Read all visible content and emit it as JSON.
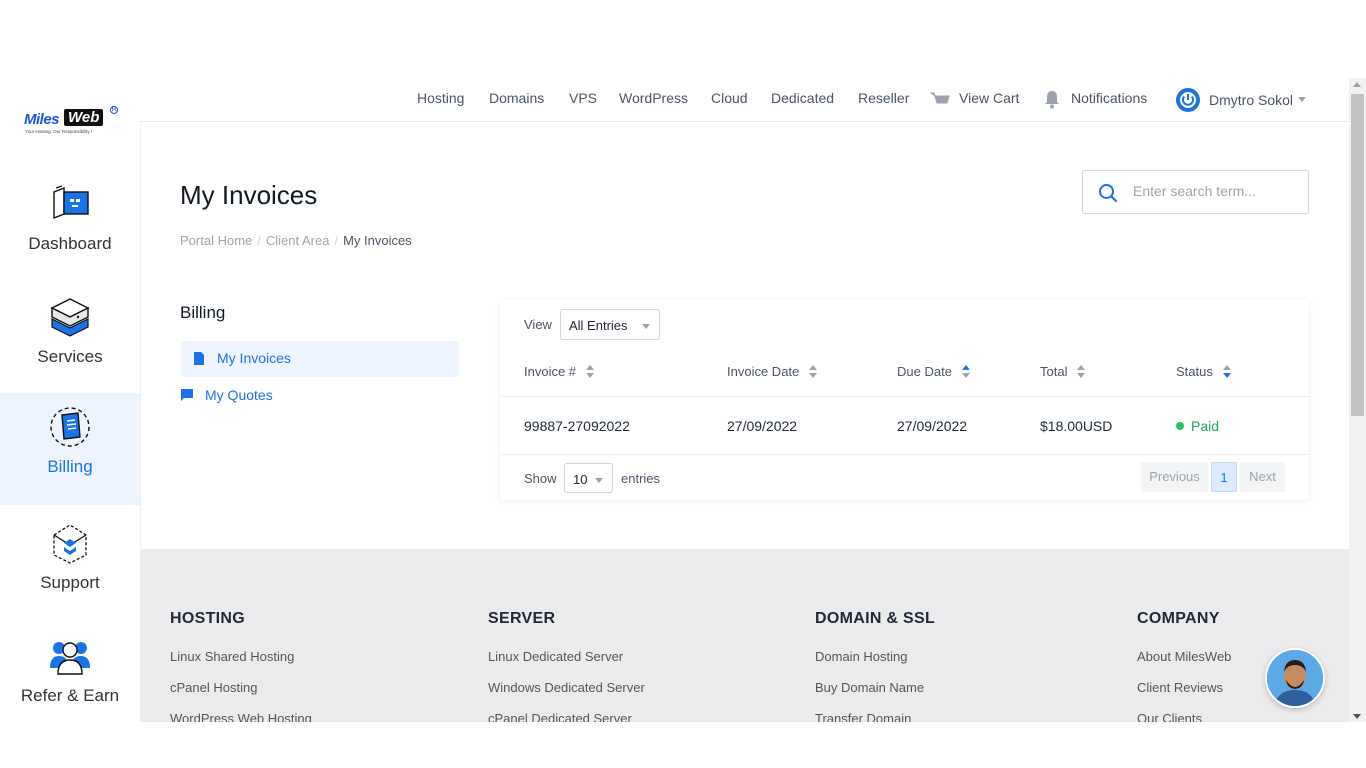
{
  "brand": {
    "name_part1": "Miles",
    "name_part2": "Web",
    "tagline": "Your Hosting, Our Responsibility !",
    "accent_color": "#1a73e8"
  },
  "sidebar": {
    "items": [
      {
        "label": "Dashboard",
        "icon": "dashboard-icon",
        "active": false
      },
      {
        "label": "Services",
        "icon": "services-icon",
        "active": false
      },
      {
        "label": "Billing",
        "icon": "billing-icon",
        "active": true
      },
      {
        "label": "Support",
        "icon": "support-icon",
        "active": false
      },
      {
        "label": "Refer & Earn",
        "icon": "refer-earn-icon",
        "active": false
      }
    ]
  },
  "topnav": {
    "links": [
      "Hosting",
      "Domains",
      "VPS",
      "WordPress",
      "Cloud",
      "Dedicated",
      "Reseller"
    ],
    "cart_label": "View Cart",
    "notifications_label": "Notifications",
    "user_name": "Dmytro Sokol"
  },
  "page": {
    "title": "My Invoices",
    "breadcrumb": [
      "Portal Home",
      "Client Area",
      "My Invoices"
    ],
    "search_placeholder": "Enter search term..."
  },
  "billing_menu": {
    "heading": "Billing",
    "items": [
      {
        "label": "My Invoices",
        "active": true
      },
      {
        "label": "My Quotes",
        "active": false
      }
    ]
  },
  "table": {
    "view_label": "View",
    "view_selected": "All Entries",
    "columns": [
      {
        "label": "Invoice #",
        "sort": "none"
      },
      {
        "label": "Invoice Date",
        "sort": "none"
      },
      {
        "label": "Due Date",
        "sort": "desc"
      },
      {
        "label": "Total",
        "sort": "none"
      },
      {
        "label": "Status",
        "sort": "desc"
      }
    ],
    "rows": [
      {
        "invoice": "99887-27092022",
        "invoice_date": "27/09/2022",
        "due_date": "27/09/2022",
        "total": "$18.00USD",
        "status": "Paid"
      }
    ],
    "show_label": "Show",
    "show_selected": "10",
    "entries_label": "entries",
    "pagination": {
      "previous": "Previous",
      "current": "1",
      "next": "Next"
    }
  },
  "footer": {
    "columns": [
      {
        "heading": "HOSTING",
        "links": [
          "Linux Shared Hosting",
          "cPanel Hosting",
          "WordPress Web Hosting"
        ]
      },
      {
        "heading": "SERVER",
        "links": [
          "Linux Dedicated Server",
          "Windows Dedicated Server",
          "cPanel Dedicated Server"
        ]
      },
      {
        "heading": "DOMAIN & SSL",
        "links": [
          "Domain Hosting",
          "Buy Domain Name",
          "Transfer Domain"
        ]
      },
      {
        "heading": "COMPANY",
        "links": [
          "About MilesWeb",
          "Client Reviews",
          "Our Clients"
        ]
      }
    ]
  }
}
